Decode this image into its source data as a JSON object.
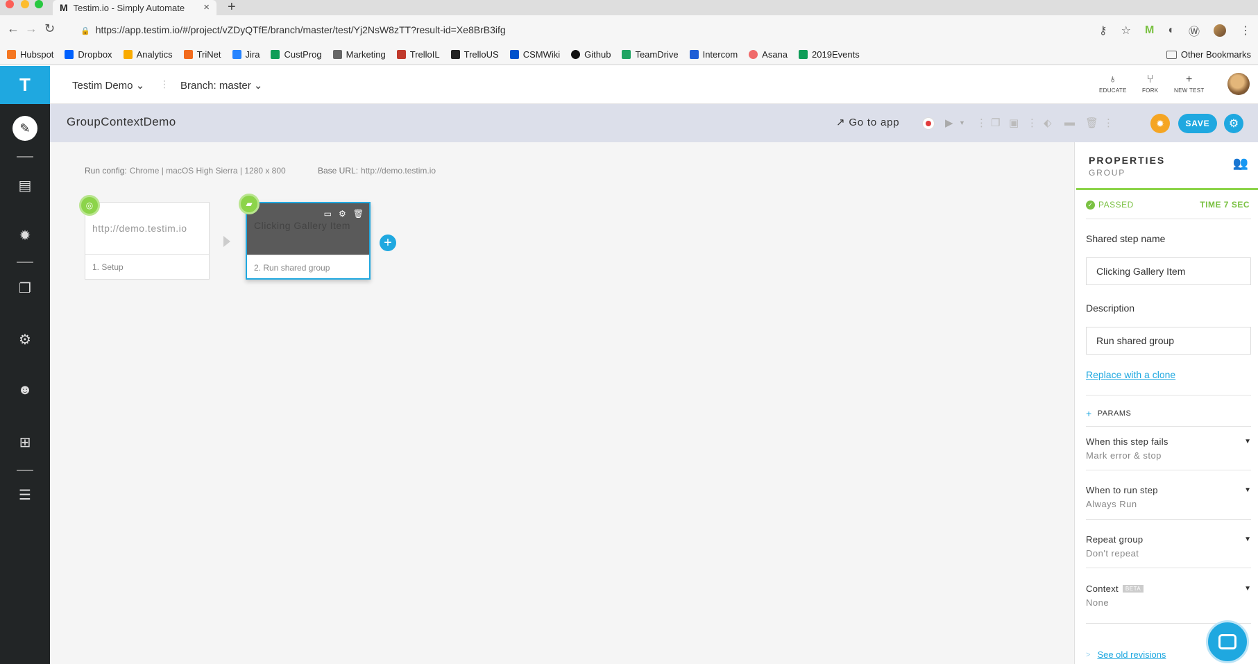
{
  "browser": {
    "tab_title": "Testim.io - Simply Automate",
    "tab_favicon": "M",
    "url": "https://app.testim.io/#/project/vZDyQTfE/branch/master/test/Yj2NsW8zTT?result-id=Xe8BrB3ifg",
    "bookmarks": [
      "Hubspot",
      "Dropbox",
      "Analytics",
      "TriNet",
      "Jira",
      "CustProg",
      "Marketing",
      "TrelloIL",
      "TrelloUS",
      "CSMWiki",
      "Github",
      "TeamDrive",
      "Intercom",
      "Asana",
      "2019Events"
    ],
    "other_bookmarks": "Other Bookmarks"
  },
  "app": {
    "logo": "T",
    "project_selector": "Testim Demo",
    "branch_selector": "Branch: master",
    "top_actions": [
      "EDUCATE",
      "FORK",
      "NEW TEST"
    ],
    "test_name": "GroupContextDemo",
    "goto_app": "Go to app",
    "save_label": "SAVE"
  },
  "canvas": {
    "run_config_label": "Run config:",
    "run_config_value": "Chrome | macOS High Sierra | 1280 x 800",
    "base_url_label": "Base URL:",
    "base_url_value": "http://demo.testim.io",
    "steps": [
      {
        "title": "http://demo.testim.io",
        "caption": "1. Setup"
      },
      {
        "title": "Clicking Gallery Item",
        "caption": "2. Run shared group"
      }
    ]
  },
  "properties": {
    "title": "PROPERTIES",
    "subtitle": "GROUP",
    "status": "PASSED",
    "time": "TIME 7 SEC",
    "shared_step_name_label": "Shared step name",
    "shared_step_name_value": "Clicking Gallery Item",
    "description_label": "Description",
    "description_value": "Run shared group",
    "replace_link": "Replace with a clone",
    "params": "PARAMS",
    "sections": [
      {
        "heading": "When this step fails",
        "value": "Mark error & stop"
      },
      {
        "heading": "When to run step",
        "value": "Always Run"
      },
      {
        "heading": "Repeat group",
        "value": "Don't repeat"
      },
      {
        "heading": "Context",
        "value": "None",
        "badge": "BETA"
      }
    ],
    "revisions_link": "See old revisions"
  },
  "colors": {
    "accent": "#1fa8e0",
    "success": "#7ac142",
    "sidebar": "#222526",
    "warning": "#f5a523"
  }
}
